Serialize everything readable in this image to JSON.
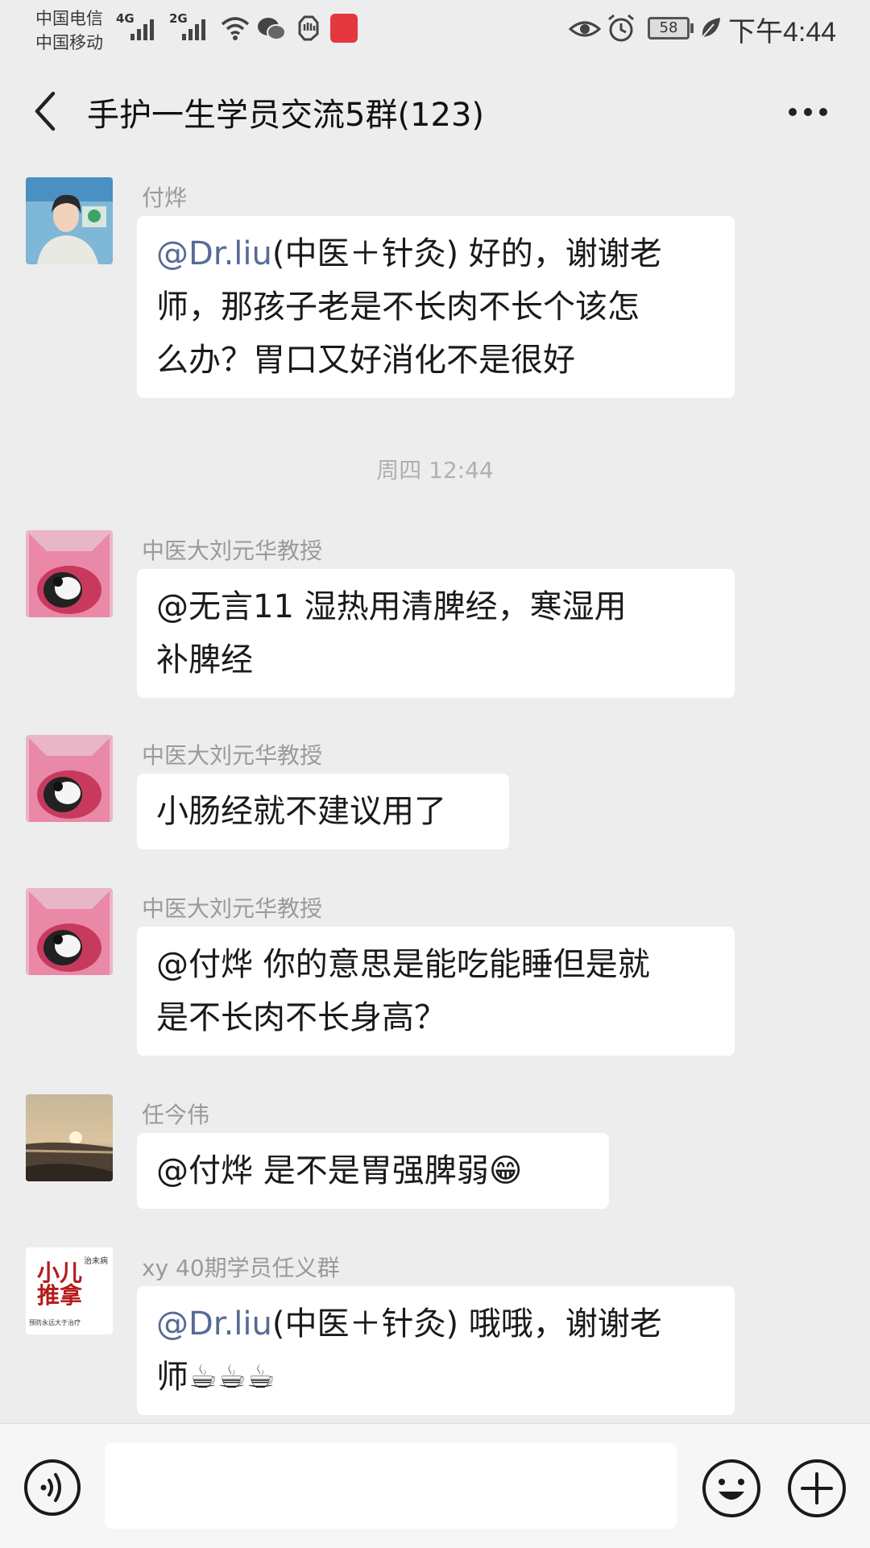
{
  "status_bar": {
    "carrier_1": "中国电信",
    "carrier_2": "中国移动",
    "net_1": "4G",
    "net_2": "2G",
    "battery": "58",
    "time": "下午4:44"
  },
  "header": {
    "title": "手护一生学员交流5群(123)"
  },
  "messages": [
    {
      "sender": "付烨",
      "mention": "@Dr.liu",
      "text_lines": [
        "(中医＋针灸) 好的，谢谢老",
        "师，那孩子老是不长肉不长个该怎",
        "么办？胃口又好消化不是很好"
      ]
    },
    {
      "sender": "中医大刘元华教授",
      "text_lines": [
        "@无言11 湿热用清脾经，寒湿用",
        "补脾经"
      ]
    },
    {
      "sender": "中医大刘元华教授",
      "text_lines": [
        "小肠经就不建议用了"
      ]
    },
    {
      "sender": "中医大刘元华教授",
      "text_lines": [
        "@付烨 你的意思是能吃能睡但是就",
        "是不长肉不长身高？"
      ]
    },
    {
      "sender": "任今伟",
      "text_lines": [
        "@付烨 是不是胃强脾弱😁"
      ]
    },
    {
      "sender": "xy 40期学员任义群",
      "mention": "@Dr.liu",
      "text_lines": [
        "(中医＋针灸) 哦哦，谢谢老",
        "师☕☕☕"
      ]
    }
  ],
  "timestamp": "周四 12:44",
  "avatar_texts": {
    "xy_badge": "治未病",
    "xy_main": "小儿推拿",
    "xy_sub": "预防永远大于治疗"
  },
  "colors": {
    "background": "#ededed",
    "bubble": "#ffffff",
    "mention_link": "#576b95",
    "sender_name": "#9a9a9a"
  },
  "icons": {
    "back": "chevron-left-icon",
    "more": "ellipsis-icon",
    "voice": "voice-icon",
    "emoji": "emoji-icon",
    "plus": "plus-icon"
  }
}
